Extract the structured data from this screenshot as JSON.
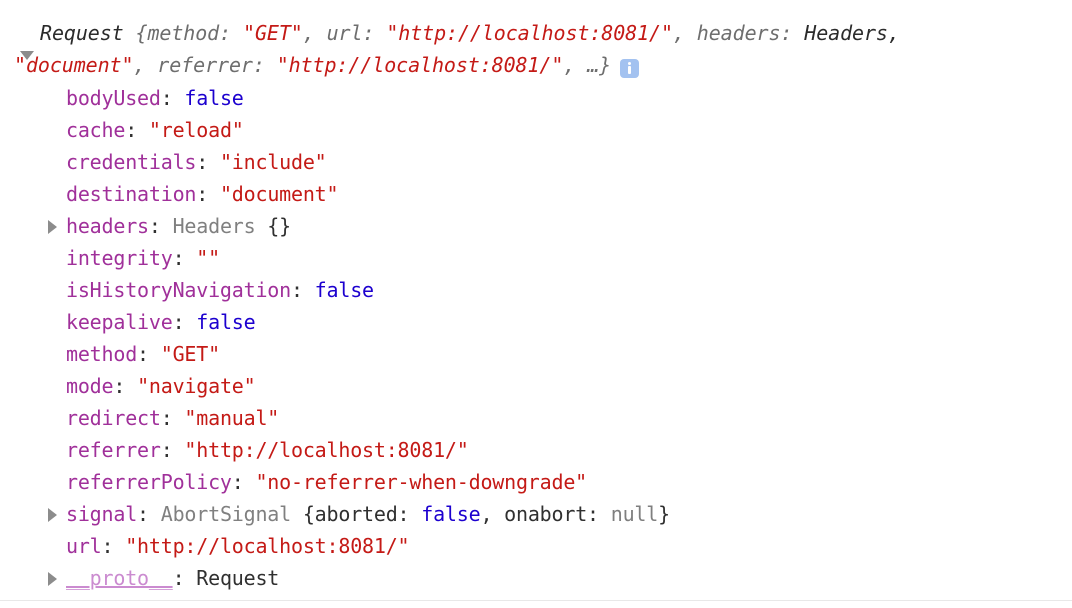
{
  "console": {
    "entry": {
      "expanded": true,
      "disclosure_open_icon": "triangle-down-icon",
      "disclosure_closed_icon": "triangle-right-icon",
      "info_icon": "info-icon",
      "preview": {
        "constructor": "Request",
        "line1": "Request {method: \"GET\", url: \"http://localhost:8081/\", headers: Headers,",
        "line2": "\"document\", referrer: \"http://localhost:8081/\", …}",
        "tokens_line1": [
          {
            "t": "Request ",
            "c": "dark-i"
          },
          {
            "t": "{method: ",
            "c": "gray-i"
          },
          {
            "t": "\"GET\"",
            "c": "str"
          },
          {
            "t": ", url: ",
            "c": "gray-i"
          },
          {
            "t": "\"http://localhost:8081/\"",
            "c": "str"
          },
          {
            "t": ", headers: ",
            "c": "gray-i"
          },
          {
            "t": "Headers,",
            "c": "dark-i"
          }
        ],
        "tokens_line2": [
          {
            "t": "\"document\"",
            "c": "str"
          },
          {
            "t": ", referrer: ",
            "c": "gray-i"
          },
          {
            "t": "\"http://localhost:8081/\"",
            "c": "str"
          },
          {
            "t": ", …}",
            "c": "gray-i"
          }
        ]
      },
      "properties": [
        {
          "expandable": false,
          "name": "bodyUsed",
          "sep": ": ",
          "value": "false",
          "value_kind": "bool"
        },
        {
          "expandable": false,
          "name": "cache",
          "sep": ": ",
          "value": "\"reload\"",
          "value_kind": "str"
        },
        {
          "expandable": false,
          "name": "credentials",
          "sep": ": ",
          "value": "\"include\"",
          "value_kind": "str"
        },
        {
          "expandable": false,
          "name": "destination",
          "sep": ": ",
          "value": "\"document\"",
          "value_kind": "str"
        },
        {
          "expandable": true,
          "name": "headers",
          "sep": ": ",
          "value": "Headers {}",
          "value_kind": "ctor-brace",
          "ctor": "Headers",
          "brace": " {}"
        },
        {
          "expandable": false,
          "name": "integrity",
          "sep": ": ",
          "value": "\"\"",
          "value_kind": "str"
        },
        {
          "expandable": false,
          "name": "isHistoryNavigation",
          "sep": ": ",
          "value": "false",
          "value_kind": "bool"
        },
        {
          "expandable": false,
          "name": "keepalive",
          "sep": ": ",
          "value": "false",
          "value_kind": "bool"
        },
        {
          "expandable": false,
          "name": "method",
          "sep": ": ",
          "value": "\"GET\"",
          "value_kind": "str"
        },
        {
          "expandable": false,
          "name": "mode",
          "sep": ": ",
          "value": "\"navigate\"",
          "value_kind": "str"
        },
        {
          "expandable": false,
          "name": "redirect",
          "sep": ": ",
          "value": "\"manual\"",
          "value_kind": "str"
        },
        {
          "expandable": false,
          "name": "referrer",
          "sep": ": ",
          "value": "\"http://localhost:8081/\"",
          "value_kind": "str"
        },
        {
          "expandable": false,
          "name": "referrerPolicy",
          "sep": ": ",
          "value": "\"no-referrer-when-downgrade\"",
          "value_kind": "str"
        },
        {
          "expandable": true,
          "name": "signal",
          "sep": ": ",
          "value": "AbortSignal {aborted: false, onabort: null}",
          "value_kind": "signal-preview",
          "ctor": "AbortSignal ",
          "parts": [
            {
              "t": "{aborted: ",
              "c": "plain"
            },
            {
              "t": "false",
              "c": "bool"
            },
            {
              "t": ", onabort: ",
              "c": "plain"
            },
            {
              "t": "null",
              "c": "nul"
            },
            {
              "t": "}",
              "c": "plain"
            }
          ]
        },
        {
          "expandable": false,
          "name": "url",
          "sep": ": ",
          "value": "\"http://localhost:8081/\"",
          "value_kind": "str"
        },
        {
          "expandable": true,
          "name": "__proto__",
          "sep": ": ",
          "value": "Request",
          "value_kind": "plain",
          "proto": true
        }
      ]
    }
  },
  "colors": {
    "property_name": "#a0309a",
    "proto_name": "#cb8bd0",
    "string": "#c41a16",
    "boolean": "#1c00cf",
    "null": "#7f7f7f",
    "constructor": "#808080",
    "plain_text": "#303030",
    "preview_italic": "#6e6e6e",
    "info_badge": "#a3c2f0",
    "background": "#ffffff",
    "divider": "#e8e8e8",
    "triangle": "#8c8c8c"
  }
}
